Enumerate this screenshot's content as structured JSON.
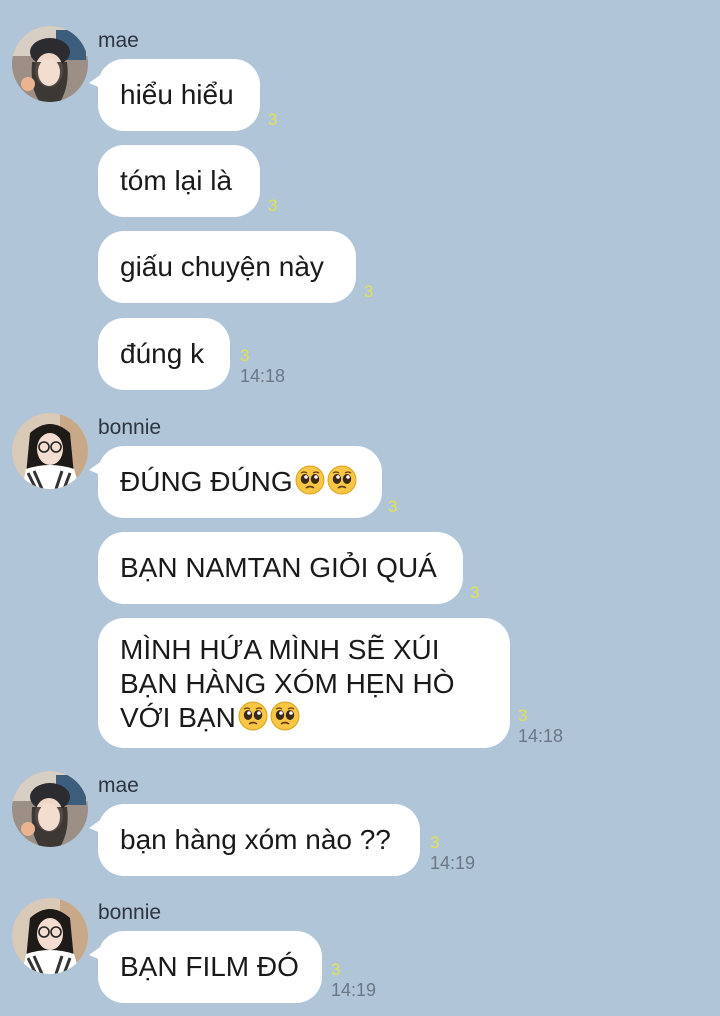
{
  "messages": [
    {
      "sender": "mae",
      "text": "hiểu hiểu",
      "read": "3",
      "time": ""
    },
    {
      "sender": "",
      "text": "tóm lại là",
      "read": "3",
      "time": ""
    },
    {
      "sender": "",
      "text": "giấu chuyện này",
      "read": "3",
      "time": ""
    },
    {
      "sender": "",
      "text": "đúng k",
      "read": "3",
      "time": "14:18"
    },
    {
      "sender": "bonnie",
      "text": "ĐÚNG ĐÚNG",
      "read": "3",
      "time": ""
    },
    {
      "sender": "",
      "text": "BẠN NAMTAN GIỎI QUÁ",
      "read": "3",
      "time": ""
    },
    {
      "sender": "",
      "line1": "MÌNH HỨA MÌNH SẼ XÚI",
      "line2": "BẠN HÀNG XÓM HẸN HÒ",
      "line3": "VỚI BẠN",
      "read": "3",
      "time": "14:18"
    },
    {
      "sender": "mae",
      "text": "bạn hàng xóm nào ??",
      "read": "3",
      "time": "14:19"
    },
    {
      "sender": "bonnie",
      "text": "BẠN FILM ĐÓ",
      "read": "3",
      "time": "14:19"
    }
  ],
  "icons": {
    "emoji": "pleading-face-emoji",
    "avatar_mae": "mae-avatar",
    "avatar_bonnie": "bonnie-avatar"
  },
  "colors": {
    "background": "#b1c5d8",
    "bubble": "#ffffff",
    "read_count": "#e3e04f",
    "timestamp": "#6b7785"
  }
}
